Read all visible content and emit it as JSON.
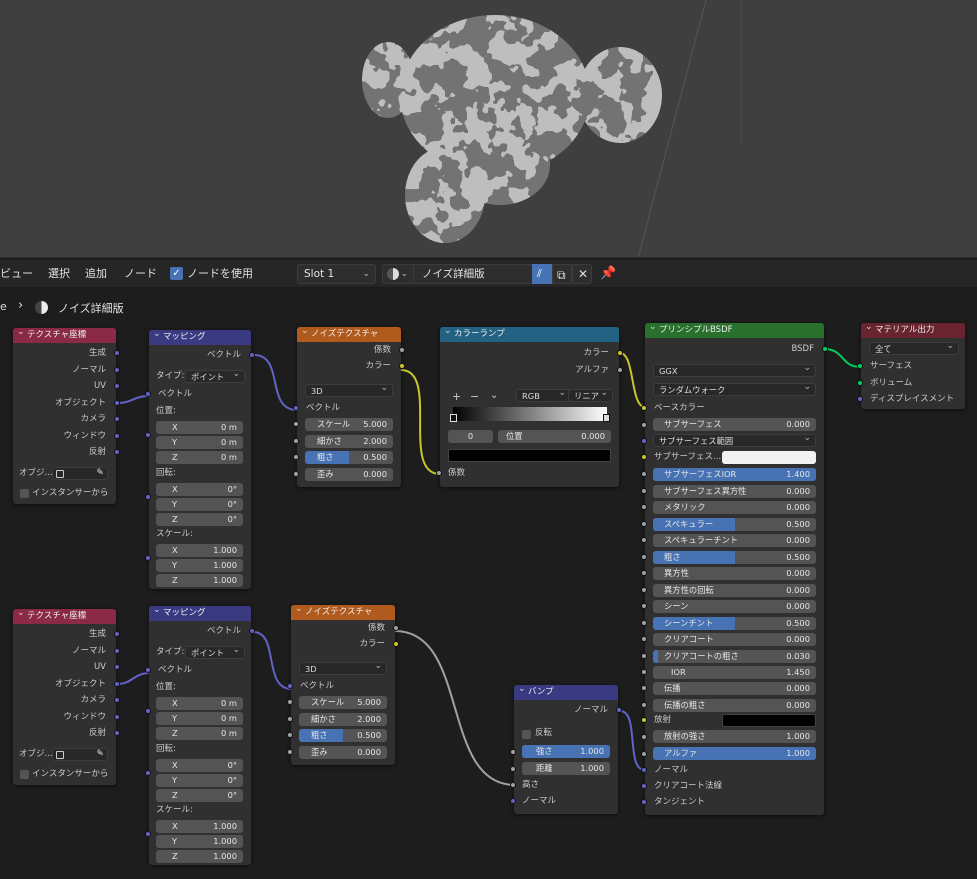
{
  "header": {
    "menus": [
      "ビュー",
      "選択",
      "追加",
      "ノード"
    ],
    "use_nodes_label": "ノードを使用",
    "slot": "Slot 1",
    "material_name": "ノイズ詳細版"
  },
  "breadcrumb": {
    "prefix": "e",
    "sep": "›",
    "material": "ノイズ詳細版"
  },
  "texcoord": {
    "title": "テクスチャ座標",
    "outputs": [
      "生成",
      "ノーマル",
      "UV",
      "オブジェクト",
      "カメラ",
      "ウィンドウ",
      "反射"
    ],
    "object_label": "オブジ...",
    "instancer_label": "インスタンサーから"
  },
  "mapping": {
    "title": "マッピング",
    "vector_out": "ベクトル",
    "type_label": "タイプ:",
    "type_value": "ポイント",
    "vector_in": "ベクトル",
    "location_label": "位置:",
    "location": [
      {
        "axis": "X",
        "value": "0 m"
      },
      {
        "axis": "Y",
        "value": "0 m"
      },
      {
        "axis": "Z",
        "value": "0 m"
      }
    ],
    "rotation_label": "回転:",
    "rotation": [
      {
        "axis": "X",
        "value": "0°"
      },
      {
        "axis": "Y",
        "value": "0°"
      },
      {
        "axis": "Z",
        "value": "0°"
      }
    ],
    "scale_label": "スケール:",
    "scale": [
      {
        "axis": "X",
        "value": "1.000"
      },
      {
        "axis": "Y",
        "value": "1.000"
      },
      {
        "axis": "Z",
        "value": "1.000"
      }
    ]
  },
  "noise": {
    "title": "ノイズテクスチャ",
    "fac_out": "係数",
    "color_out": "カラー",
    "dim": "3D",
    "vector_in": "ベクトル",
    "fields": [
      {
        "label": "スケール",
        "value": "5.000",
        "fill": 0
      },
      {
        "label": "細かさ",
        "value": "2.000",
        "fill": 0
      },
      {
        "label": "粗さ",
        "value": "0.500",
        "fill": 0.5
      },
      {
        "label": "歪み",
        "value": "0.000",
        "fill": 0
      }
    ]
  },
  "colorramp": {
    "title": "カラーランプ",
    "color_out": "カラー",
    "alpha_out": "アルファ",
    "plus": "+",
    "minus": "−",
    "mode": "RGB",
    "interp": "リニア",
    "index": "0",
    "pos_label": "位置",
    "pos_value": "0.000",
    "fac_in": "係数"
  },
  "bump": {
    "title": "バンプ",
    "normal_out": "ノーマル",
    "invert_label": "反転",
    "strength_label": "強さ",
    "strength_value": "1.000",
    "strength_fill": 1.0,
    "distance_label": "距離",
    "distance_value": "1.000",
    "height_in": "高さ",
    "normal_in": "ノーマル"
  },
  "bsdf": {
    "title": "プリンシプルBSDF",
    "bsdf_out": "BSDF",
    "distribution": "GGX",
    "subsurface_method": "ランダムウォーク",
    "base_color_label": "ベースカラー",
    "subsurface": {
      "label": "サブサーフェス",
      "value": "0.000"
    },
    "subsurface_radius": "サブサーフェス範囲",
    "subsurface_color": "サブサーフェス...",
    "fields": [
      {
        "label": "サブサーフェスIOR",
        "value": "1.400",
        "fill": 1.0
      },
      {
        "label": "サブサーフェス異方性",
        "value": "0.000",
        "fill": 0
      },
      {
        "label": "メタリック",
        "value": "0.000",
        "fill": 0
      },
      {
        "label": "スペキュラー",
        "value": "0.500",
        "fill": 0.5
      },
      {
        "label": "スペキュラーチント",
        "value": "0.000",
        "fill": 0
      },
      {
        "label": "粗さ",
        "value": "0.500",
        "fill": 0.5
      },
      {
        "label": "異方性",
        "value": "0.000",
        "fill": 0
      },
      {
        "label": "異方性の回転",
        "value": "0.000",
        "fill": 0
      },
      {
        "label": "シーン",
        "value": "0.000",
        "fill": 0
      },
      {
        "label": "シーンチント",
        "value": "0.500",
        "fill": 0.5
      },
      {
        "label": "クリアコート",
        "value": "0.000",
        "fill": 0
      },
      {
        "label": "クリアコートの粗さ",
        "value": "0.030",
        "fill": 0.03
      },
      {
        "label": "IOR",
        "value": "1.450",
        "fill": 0
      }
    ],
    "fields2": [
      {
        "label": "伝播",
        "value": "0.000",
        "fill": 0
      },
      {
        "label": "伝播の粗さ",
        "value": "0.000",
        "fill": 0
      }
    ],
    "emission_label": "放射",
    "emission_strength": {
      "label": "放射の強さ",
      "value": "1.000",
      "fill": 0
    },
    "alpha": {
      "label": "アルファ",
      "value": "1.000",
      "fill": 1.0
    },
    "normal_in": "ノーマル",
    "clearcoat_normal": "クリアコート法線",
    "tangent": "タンジェント"
  },
  "output": {
    "title": "マテリアル出力",
    "target": "全て",
    "inputs": [
      "サーフェス",
      "ボリューム",
      "ディスプレイスメント"
    ]
  },
  "colors": {
    "texture_header": "#8a2a47",
    "vector_header": "#3a3a83",
    "texnode_header": "#b15a1e",
    "converter_header": "#246283",
    "shader_header": "#29702d",
    "output_header": "#6a2430",
    "accent": "#4772b3"
  }
}
